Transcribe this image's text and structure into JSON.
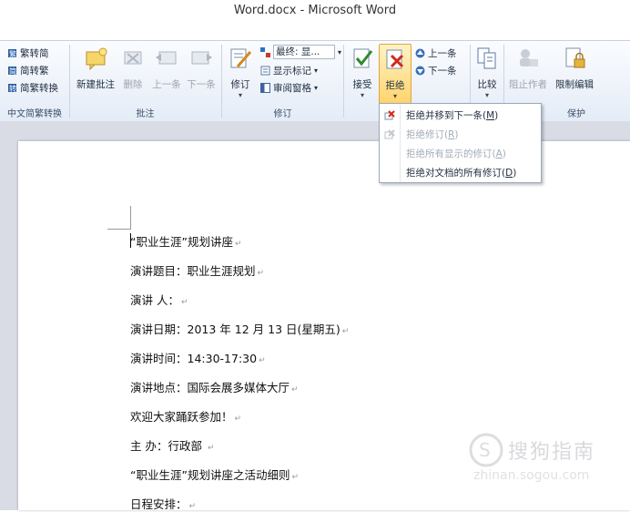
{
  "window": {
    "title": "Word.docx - Microsoft Word"
  },
  "ribbon": {
    "chinese_group": {
      "items": [
        "繁转简",
        "简转繁",
        "简繁转换"
      ],
      "label": "中文简繁转换"
    },
    "comments_group": {
      "new_comment": "新建批注",
      "delete": "删除",
      "previous": "上一条",
      "next": "下一条",
      "label": "批注"
    },
    "tracking_group": {
      "track_changes": "修订",
      "display_for_review": "最终: 显...",
      "show_markup": "显示标记",
      "reviewing_pane": "审阅窗格",
      "label": "修订"
    },
    "changes_group": {
      "accept": "接受",
      "reject": "拒绝",
      "previous": "上一条",
      "next": "下一条"
    },
    "compare_group": {
      "compare": "比较"
    },
    "protect_group": {
      "block_authors": "阻止作者",
      "restrict_editing": "限制编辑",
      "label": "保护"
    }
  },
  "reject_menu": {
    "items": [
      {
        "label": "拒绝并移到下一条(",
        "key": "M",
        "end": ")",
        "enabled": true
      },
      {
        "label": "拒绝修订(",
        "key": "R",
        "end": ")",
        "enabled": false
      },
      {
        "label": "拒绝所有显示的修订(",
        "key": "A",
        "end": ")",
        "enabled": false
      },
      {
        "label": "拒绝对文档的所有修订(",
        "key": "D",
        "end": ")",
        "enabled": true
      }
    ]
  },
  "document": {
    "lines": [
      "“职业生涯”规划讲座",
      "演讲题目：职业生涯规划",
      "演讲 人：",
      "演讲日期：2013 年 12 月 13 日(星期五)",
      "演讲时间：14:30-17:30",
      "演讲地点：国际会展多媒体大厅",
      "欢迎大家踊跃参加！",
      "主 办：行政部 ",
      "“职业生涯”规划讲座之活动细则",
      "日程安排："
    ],
    "paragraph_mark": "↵"
  },
  "watermark": {
    "brand": "搜狗指南",
    "url": "zhinan.sogou.com"
  },
  "colors": {
    "ribbon_top": "#fbfcfe",
    "ribbon_bottom": "#e4ecf7",
    "reject_highlight": "#ffd36a",
    "page_bg": "#d9dce4"
  }
}
